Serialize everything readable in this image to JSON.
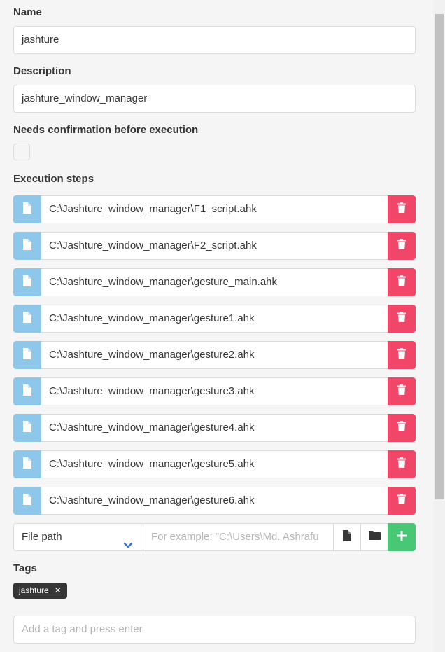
{
  "form": {
    "name": {
      "label": "Name",
      "value": "jashture"
    },
    "description": {
      "label": "Description",
      "value": "jashture_window_manager"
    },
    "confirmation": {
      "label": "Needs confirmation before execution",
      "checked": false
    },
    "steps": {
      "label": "Execution steps",
      "items": [
        "C:\\Jashture_window_manager\\F1_script.ahk",
        "C:\\Jashture_window_manager\\F2_script.ahk",
        "C:\\Jashture_window_manager\\gesture_main.ahk",
        "C:\\Jashture_window_manager\\gesture1.ahk",
        "C:\\Jashture_window_manager\\gesture2.ahk",
        "C:\\Jashture_window_manager\\gesture3.ahk",
        "C:\\Jashture_window_manager\\gesture4.ahk",
        "C:\\Jashture_window_manager\\gesture5.ahk",
        "C:\\Jashture_window_manager\\gesture6.ahk"
      ],
      "step_icon": "file-icon",
      "delete_icon": "trash-icon",
      "adder": {
        "type_selected": "File path",
        "placeholder": "For example: \"C:\\Users\\Md. Ashrafu",
        "icons": [
          "file-icon",
          "folder-icon",
          "plus-icon"
        ]
      }
    },
    "tags": {
      "label": "Tags",
      "items": [
        "jashture"
      ],
      "input_placeholder": "Add a tag and press enter"
    }
  },
  "colors": {
    "info_light": "#8fc7ea",
    "danger": "#f14668",
    "success": "#48c774",
    "dark": "#363636"
  }
}
